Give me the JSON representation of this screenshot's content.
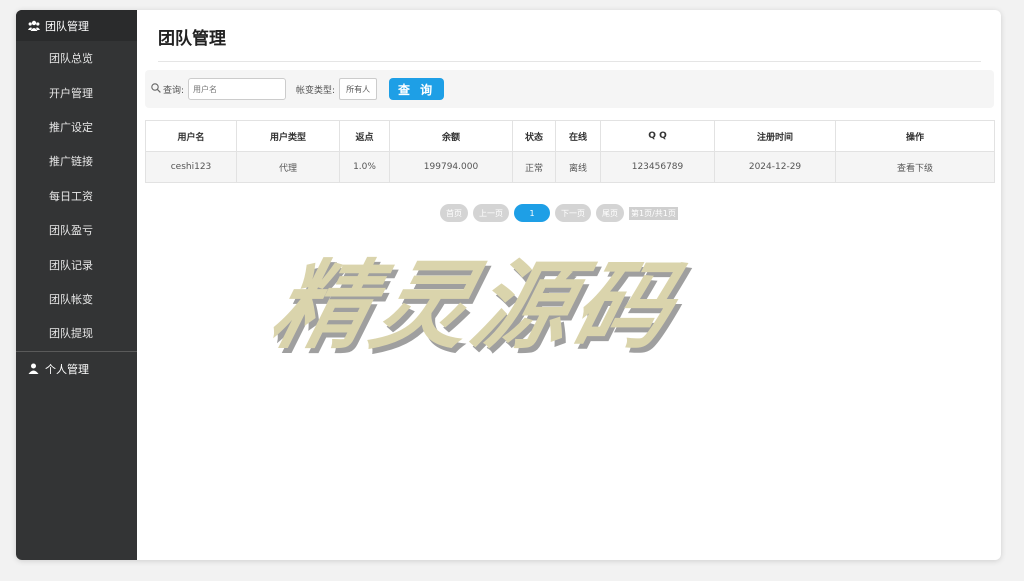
{
  "sidebar": {
    "header_label": "团队管理",
    "items": [
      {
        "label": "团队总览"
      },
      {
        "label": "开户管理"
      },
      {
        "label": "推广设定"
      },
      {
        "label": "推广链接"
      },
      {
        "label": "每日工资"
      },
      {
        "label": "团队盈亏"
      },
      {
        "label": "团队记录"
      },
      {
        "label": "团队帐变"
      },
      {
        "label": "团队提现"
      }
    ],
    "personal_label": "个人管理"
  },
  "main": {
    "title": "团队管理"
  },
  "search": {
    "query_label": "查询:",
    "username_placeholder": "用户名",
    "type_label": "帐变类型:",
    "type_selected": "所有人",
    "button_label": "查 询"
  },
  "table": {
    "headers": [
      "用户名",
      "用户类型",
      "返点",
      "余额",
      "状态",
      "在线",
      "Q Q",
      "注册时间",
      "操作"
    ],
    "rows": [
      [
        "ceshi123",
        "代理",
        "1.0%",
        "199794.000",
        "正常",
        "离线",
        "123456789",
        "2024-12-29",
        "查看下级"
      ]
    ]
  },
  "pagination": {
    "first": "首页",
    "prev": "上一页",
    "current": "1",
    "next": "下一页",
    "last": "尾页",
    "info": "第1页/共1页"
  },
  "watermark": "精灵源码",
  "colors": {
    "sidebar_bg": "#333435",
    "accent": "#1e9fe6"
  }
}
